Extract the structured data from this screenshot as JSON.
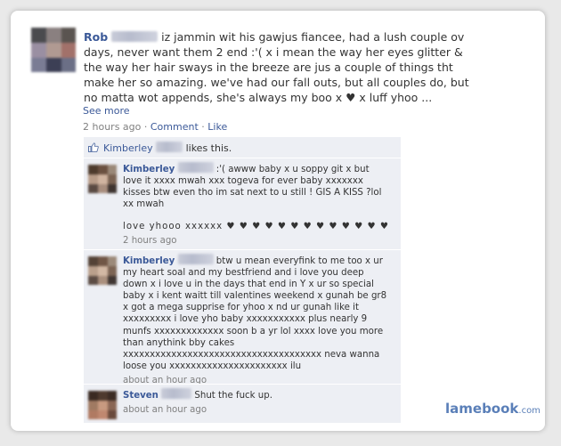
{
  "post": {
    "author": "Rob",
    "text": "iz jammin wit his gawjus fiancee, had a lush couple ov days, never want them 2 end :'( x i mean the way her eyes glitter & the way her hair sways in the breeze are jus a couple of things tht make her so amazing. we've had our fall outs, but all couples do, but no matta wot appends, she's always my boo x ♥ x luff yhoo ...",
    "see_more": "See more",
    "time": "2 hours ago",
    "separator": "·",
    "comment_label": "Comment",
    "like_label": "Like"
  },
  "likes": {
    "name": "Kimberley",
    "suffix": "likes this."
  },
  "comments": [
    {
      "author": "Kimberley",
      "text": ":'( awww baby x u soppy git x but love it xxxx mwah xxx togeva for ever baby xxxxxxx kisses btw even tho im sat next to u still ! GIS A KISS ?lol xx mwah",
      "text2": "love yhooo xxxxxx ♥ ♥ ♥ ♥ ♥ ♥ ♥ ♥ ♥ ♥ ♥ ♥ ♥",
      "time": "2 hours ago"
    },
    {
      "author": "Kimberley",
      "text": "btw u mean everyfink to me too x ur my heart soal and my bestfriend and i love you deep down x i love u in the days that end in Y x ur so special baby x i kent waitt till valentines weekend x gunah be gr8 x got a mega supprise for yhoo x nd ur gunah like it xxxxxxxxx i love yho baby xxxxxxxxxxx plus nearly 9 munfs xxxxxxxxxxxxx soon b a yr lol xxxx love you more than anythink bby cakes xxxxxxxxxxxxxxxxxxxxxxxxxxxxxxxxxxxxx neva wanna loose you xxxxxxxxxxxxxxxxxxxxxx ilu",
      "time": "about an hour ago"
    },
    {
      "author": "Steven",
      "text": "Shut the fuck up.",
      "time": "about an hour ago"
    }
  ],
  "watermark": {
    "main": "lamebook",
    "suffix": ".com"
  },
  "colors": {
    "link": "#3b5998",
    "comment_bg": "#edeff4",
    "watermark": "#5a7fb8"
  }
}
